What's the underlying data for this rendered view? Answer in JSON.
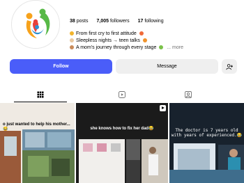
{
  "profile": {
    "stats": {
      "posts_count": "38",
      "posts_label": "posts",
      "followers_count": "7,005",
      "followers_label": "followers",
      "following_count": "17",
      "following_label": "following"
    },
    "bio": [
      "From first cry to first attitude",
      "Sleepless nights → teen talks",
      "A mom's journey through every stage"
    ],
    "more_label": "... more"
  },
  "actions": {
    "follow_label": "Follow",
    "message_label": "Message"
  },
  "colors": {
    "follow_button": "#4a5df9",
    "secondary_button": "#efefef",
    "text": "#000000",
    "muted": "#737373"
  },
  "tabs": [
    {
      "icon": "grid-icon",
      "active": true
    },
    {
      "icon": "reels-icon",
      "active": false
    },
    {
      "icon": "tagged-icon",
      "active": false
    }
  ],
  "posts": [
    {
      "caption": "o just wanted to help his mother...😂",
      "reel": false
    },
    {
      "caption": "she knows how to fix her dad😂",
      "reel": true
    },
    {
      "caption": "The doctor is 7 years old with years of experienced.😂",
      "reel": false
    }
  ]
}
